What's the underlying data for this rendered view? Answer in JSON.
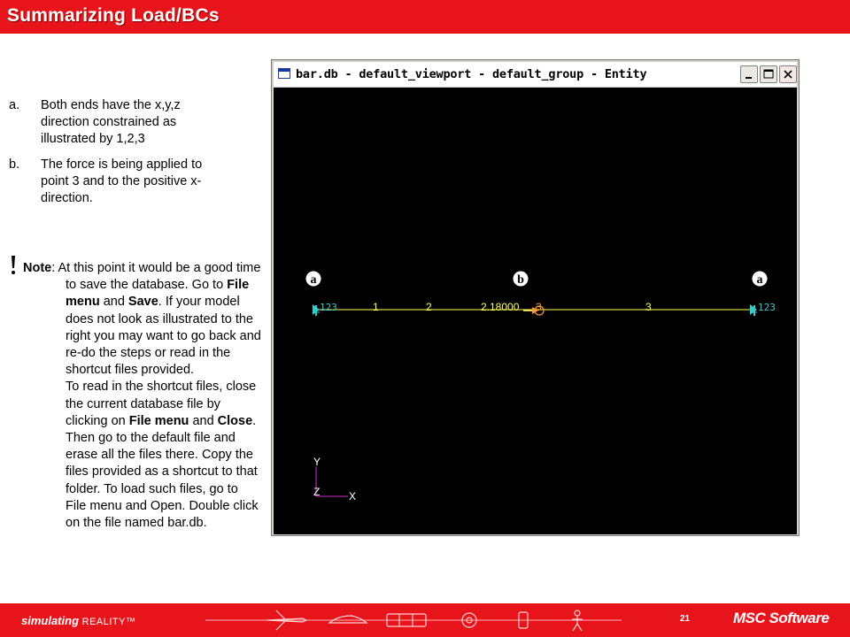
{
  "header": {
    "title": "Summarizing Load/BCs"
  },
  "list": [
    {
      "marker": "a.",
      "text": "Both ends have the x,y,z direction constrained as illustrated by 1,2,3"
    },
    {
      "marker": "b.",
      "text": "The force is being applied to point 3 and to the positive x-direction."
    }
  ],
  "note": {
    "label": "Note",
    "p1_a": ": At this point it would be a good time to save the database. Go to ",
    "p1_b": "File menu",
    "p1_c": " and ",
    "p1_d": "Save",
    "p1_e": ". If your model does not look as illustrated to the right you may want to go back and re-do the steps or read in the shortcut files provided.",
    "p2_a": "To read in the shortcut files, close the current database file by clicking on ",
    "p2_b": "File menu",
    "p2_c": " and ",
    "p2_d": "Close",
    "p2_e": ". Then go to the default file and erase all the files there. Copy the files provided as a shortcut to that folder. To load such files, go to File menu and Open. Double click on the file named bar.db."
  },
  "window": {
    "title": "bar.db - default_viewport - default_group - Entity",
    "buttons": [
      "minimize",
      "maximize",
      "close"
    ],
    "icons": [
      "app-icon",
      "minimize-icon",
      "maximize-icon",
      "close-icon"
    ]
  },
  "viewport": {
    "callouts": [
      "a",
      "b",
      "a"
    ],
    "labels": {
      "left_constraint": "123",
      "node1": "1",
      "node2": "2",
      "force_value": "2.18000",
      "force_node": "3",
      "element3": "3",
      "right_constraint": "123"
    },
    "axes": {
      "y": "Y",
      "z": "Z",
      "x": "X"
    },
    "colors": {
      "background": "#000000",
      "bar": "#ffff66",
      "constraint": "#33cccc",
      "force": "#ff9933",
      "axis": "#ffffff",
      "axis_z": "#cc33cc"
    }
  },
  "footer": {
    "brand": "simulating",
    "brand_tail": "REALITY™",
    "page": "21",
    "logo": "MSC Software"
  },
  "colors": {
    "accent": "#e8141b"
  }
}
